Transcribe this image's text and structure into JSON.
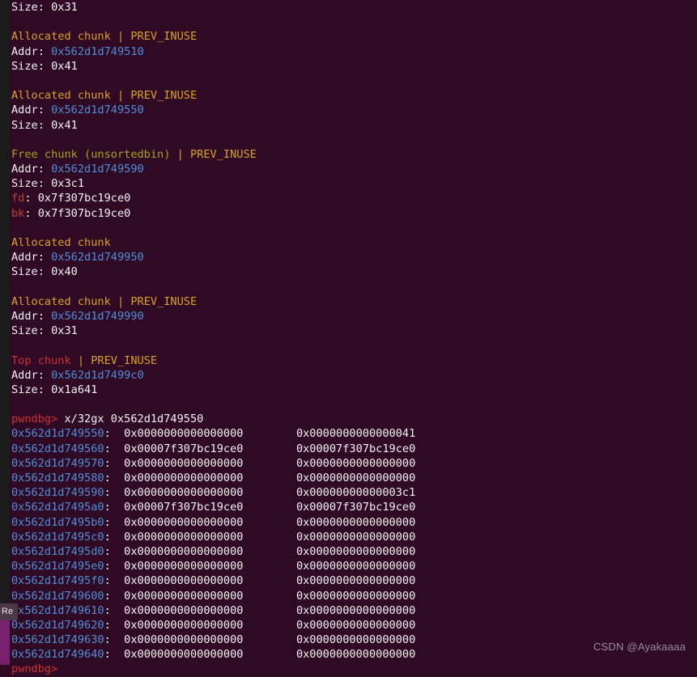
{
  "terminal": {
    "background_color": "#300a24",
    "foreground_color": "#f2f2f2",
    "colors": {
      "allocated": "#d8a227",
      "free": "#a5a520",
      "top": "#cc3333",
      "address": "#4e8fd8",
      "pointer_label": "#b5452f",
      "prompt": "#cc3333"
    },
    "lines": [
      {
        "t": "size_only",
        "label": "Size: ",
        "value": "0x31"
      },
      {
        "t": "blank"
      },
      {
        "t": "header_alloc",
        "title": "Allocated chunk",
        "sep": " | ",
        "flag": "PREV_INUSE"
      },
      {
        "t": "addr",
        "label": "Addr: ",
        "value": "0x562d1d749510"
      },
      {
        "t": "size_only",
        "label": "Size: ",
        "value": "0x41"
      },
      {
        "t": "blank"
      },
      {
        "t": "header_alloc",
        "title": "Allocated chunk",
        "sep": " | ",
        "flag": "PREV_INUSE"
      },
      {
        "t": "addr",
        "label": "Addr: ",
        "value": "0x562d1d749550"
      },
      {
        "t": "size_only",
        "label": "Size: ",
        "value": "0x41"
      },
      {
        "t": "blank"
      },
      {
        "t": "header_free",
        "title": "Free chunk (unsortedbin)",
        "sep": " | ",
        "flag": "PREV_INUSE"
      },
      {
        "t": "addr",
        "label": "Addr: ",
        "value": "0x562d1d749590"
      },
      {
        "t": "size_only",
        "label": "Size: ",
        "value": "0x3c1"
      },
      {
        "t": "ptr",
        "label": "fd",
        "rest": ": 0x7f307bc19ce0"
      },
      {
        "t": "ptr",
        "label": "bk",
        "rest": ": 0x7f307bc19ce0"
      },
      {
        "t": "blank"
      },
      {
        "t": "header_alloc",
        "title": "Allocated chunk",
        "sep": "",
        "flag": ""
      },
      {
        "t": "addr",
        "label": "Addr: ",
        "value": "0x562d1d749950"
      },
      {
        "t": "size_only",
        "label": "Size: ",
        "value": "0x40"
      },
      {
        "t": "blank"
      },
      {
        "t": "header_alloc",
        "title": "Allocated chunk",
        "sep": " | ",
        "flag": "PREV_INUSE"
      },
      {
        "t": "addr",
        "label": "Addr: ",
        "value": "0x562d1d749990"
      },
      {
        "t": "size_only",
        "label": "Size: ",
        "value": "0x31"
      },
      {
        "t": "blank"
      },
      {
        "t": "header_top",
        "title": "Top chunk",
        "sep": " | ",
        "flag": "PREV_INUSE"
      },
      {
        "t": "addr",
        "label": "Addr: ",
        "value": "0x562d1d7499c0"
      },
      {
        "t": "size_only",
        "label": "Size: ",
        "value": "0x1a641"
      },
      {
        "t": "blank"
      },
      {
        "t": "prompt_cmd",
        "prompt": "pwndbg>",
        "cmd": " x/32gx 0x562d1d749550"
      },
      {
        "t": "dump",
        "addr": "0x562d1d749550",
        "w1": "0x0000000000000000",
        "w2": "0x0000000000000041"
      },
      {
        "t": "dump",
        "addr": "0x562d1d749560",
        "w1": "0x00007f307bc19ce0",
        "w2": "0x00007f307bc19ce0"
      },
      {
        "t": "dump",
        "addr": "0x562d1d749570",
        "w1": "0x0000000000000000",
        "w2": "0x0000000000000000"
      },
      {
        "t": "dump",
        "addr": "0x562d1d749580",
        "w1": "0x0000000000000000",
        "w2": "0x0000000000000000"
      },
      {
        "t": "dump",
        "addr": "0x562d1d749590",
        "w1": "0x0000000000000000",
        "w2": "0x00000000000003c1"
      },
      {
        "t": "dump",
        "addr": "0x562d1d7495a0",
        "w1": "0x00007f307bc19ce0",
        "w2": "0x00007f307bc19ce0"
      },
      {
        "t": "dump",
        "addr": "0x562d1d7495b0",
        "w1": "0x0000000000000000",
        "w2": "0x0000000000000000"
      },
      {
        "t": "dump",
        "addr": "0x562d1d7495c0",
        "w1": "0x0000000000000000",
        "w2": "0x0000000000000000"
      },
      {
        "t": "dump",
        "addr": "0x562d1d7495d0",
        "w1": "0x0000000000000000",
        "w2": "0x0000000000000000"
      },
      {
        "t": "dump",
        "addr": "0x562d1d7495e0",
        "w1": "0x0000000000000000",
        "w2": "0x0000000000000000"
      },
      {
        "t": "dump",
        "addr": "0x562d1d7495f0",
        "w1": "0x0000000000000000",
        "w2": "0x0000000000000000"
      },
      {
        "t": "dump",
        "addr": "0x562d1d749600",
        "w1": "0x0000000000000000",
        "w2": "0x0000000000000000"
      },
      {
        "t": "dump",
        "addr": "0x562d1d749610",
        "w1": "0x0000000000000000",
        "w2": "0x0000000000000000"
      },
      {
        "t": "dump",
        "addr": "0x562d1d749620",
        "w1": "0x0000000000000000",
        "w2": "0x0000000000000000"
      },
      {
        "t": "dump",
        "addr": "0x562d1d749630",
        "w1": "0x0000000000000000",
        "w2": "0x0000000000000000"
      },
      {
        "t": "dump",
        "addr": "0x562d1d749640",
        "w1": "0x0000000000000000",
        "w2": "0x0000000000000000"
      },
      {
        "t": "prompt_only",
        "prompt": "pwndbg>"
      }
    ]
  },
  "dock": {
    "tooltip_text": "Re",
    "strip_color": "#1b1b1b",
    "highlight_color": "#77216f"
  },
  "watermark": {
    "text": "CSDN @Ayakaaaa"
  }
}
